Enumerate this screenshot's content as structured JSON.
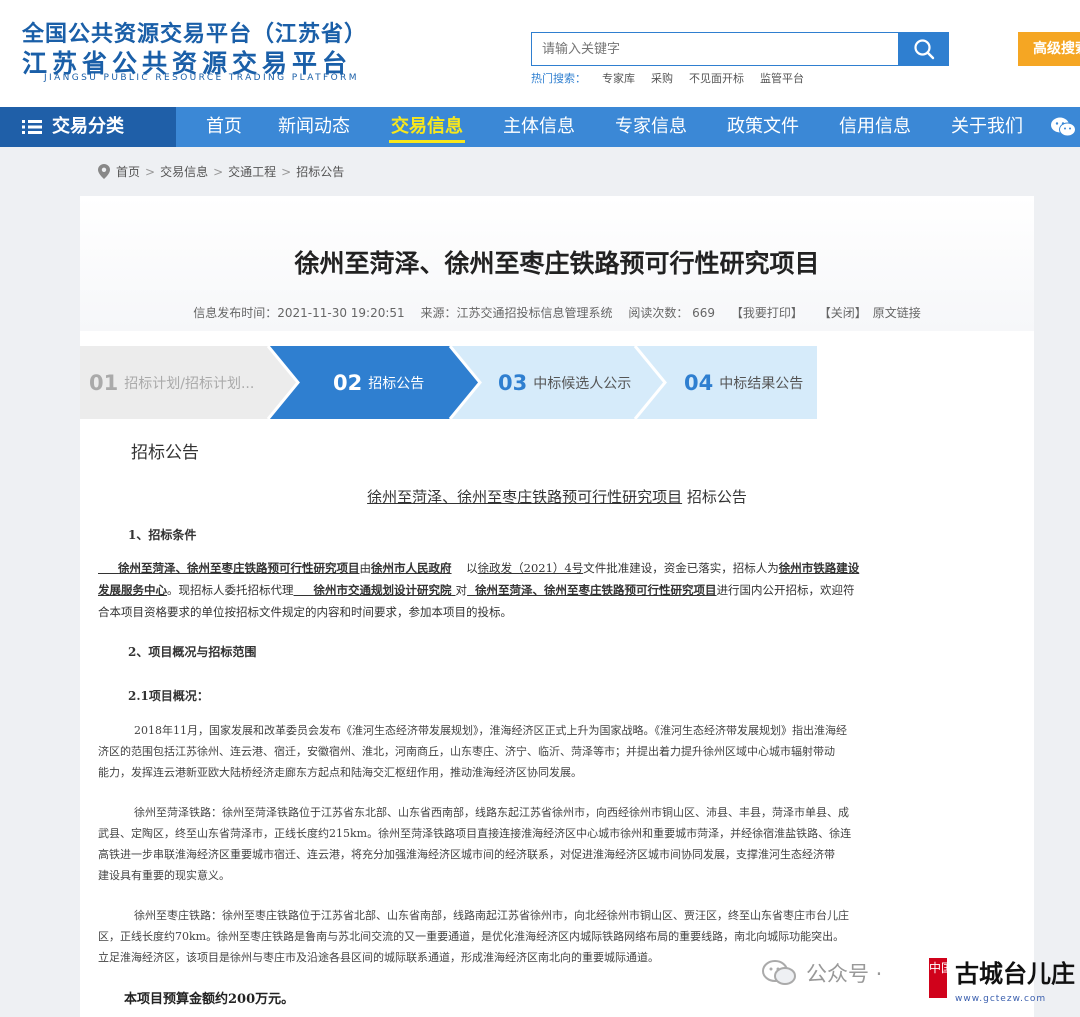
{
  "header": {
    "logo_line1": "全国公共资源交易平台（江苏省）",
    "logo_line2": "江苏省公共资源交易平台",
    "logo_en": "JIANGSU PUBLIC RESOURCE TRADING PLATFORM",
    "search_placeholder": "请输入关键字",
    "hot_label": "热门搜索：",
    "hot_items": [
      "专家库",
      "采购",
      "不见面开标",
      "监管平台"
    ],
    "advanced_search": "高级搜索"
  },
  "nav": {
    "category": "交易分类",
    "items": [
      "首页",
      "新闻动态",
      "交易信息",
      "主体信息",
      "专家信息",
      "政策文件",
      "信用信息",
      "关于我们"
    ],
    "active_index": 2
  },
  "breadcrumb": [
    "首页",
    "交易信息",
    "交通工程",
    "招标公告"
  ],
  "article": {
    "title": "徐州至菏泽、徐州至枣庄铁路预可行性研究项目",
    "meta": {
      "publish_time": "信息发布时间：2021-11-30 19:20:51",
      "source": "来源：江苏交通招投标信息管理系统",
      "views": "阅读次数：  669",
      "print": "【我要打印】",
      "close": "【关闭】",
      "original": "原文链接"
    },
    "steps": [
      {
        "num": "01",
        "label": "招标计划/招标计划..."
      },
      {
        "num": "02",
        "label": "招标公告"
      },
      {
        "num": "03",
        "label": "中标候选人公示"
      },
      {
        "num": "04",
        "label": "中标结果公告"
      }
    ],
    "active_step": 1,
    "section_heading": "招标公告",
    "sub_title_project": "徐州至菏泽、徐州至枣庄铁路预可行性研究项目",
    "sub_title_suffix": "招标公告",
    "h1_title": "1、招标条件",
    "cond_line1": {
      "project": "徐州至菏泽、徐州至枣庄铁路预可行性研究项目",
      "t1": "由",
      "org": "徐州市人民政府",
      "t2": "以",
      "doc": "徐政发（2021）4号",
      "t3": "文件批准建设，资金已落实，招标人为",
      "tenderer": "徐州市铁路建设"
    },
    "cond_line2": {
      "tenderer2": "发展服务中心",
      "t1": "。现招标人委托招标代理",
      "agent": "徐州市交通规划设计研究院",
      "t2": "对",
      "project": "徐州至菏泽、徐州至枣庄铁路预可行性研究项目",
      "t3": "进行国内公开招标，欢迎符"
    },
    "cond_line3": "合本项目资格要求的单位按招标文件规定的内容和时间要求，参加本项目的投标。",
    "h2_title": "2、项目概况与招标范围",
    "h21_title": "2.1项目概况：",
    "para1": [
      "2018年11月，国家发展和改革委员会发布《淮河生态经济带发展规划》，淮海经济区正式上升为国家战略。《淮河生态经济带发展规划》指出淮海经",
      "济区的范围包括江苏徐州、连云港、宿迁，安徽宿州、淮北，河南商丘，山东枣庄、济宁、临沂、菏泽等市；并提出着力提升徐州区域中心城市辐射带动",
      "能力，发挥连云港新亚欧大陆桥经济走廊东方起点和陆海交汇枢纽作用，推动淮海经济区协同发展。"
    ],
    "para2": [
      "徐州至菏泽铁路：徐州至菏泽铁路位于江苏省东北部、山东省西南部，线路东起江苏省徐州市，向西经徐州市铜山区、沛县、丰县，菏泽市单县、成",
      "武县、定陶区，终至山东省菏泽市，正线长度约215km。徐州至菏泽铁路项目直接连接淮海经济区中心城市徐州和重要城市菏泽，并经徐宿淮盐铁路、徐连",
      "高铁进一步串联淮海经济区重要城市宿迁、连云港，将充分加强淮海经济区城市间的经济联系，对促进淮海经济区城市间协同发展，支撑淮河生态经济带",
      "建设具有重要的现实意义。"
    ],
    "para3": [
      "徐州至枣庄铁路：徐州至枣庄铁路位于江苏省北部、山东省南部，线路南起江苏省徐州市，向北经徐州市铜山区、贾汪区，终至山东省枣庄市台儿庄",
      "区，正线长度约70km。徐州至枣庄铁路是鲁南与苏北间交流的又一重要通道，是优化淮海经济区内城际铁路网络布局的重要线路，南北向城际功能突出。",
      "立足淮海经济区，该项目是徐州与枣庄市及沿途各县区间的城际联系通道，形成淮海经济区南北向的重要城际通道。"
    ],
    "budget": "本项目预算金额约200万元。"
  },
  "watermark": {
    "official_account": "公众号 ·",
    "seal_text": "中国",
    "name": "古城台儿庄",
    "url": "www.gctezw.com"
  },
  "colors": {
    "nav_bg": "#3b88d6",
    "nav_category_bg": "#1f5fa8",
    "active_nav": "#f8e71c",
    "step_active": "#2f7fd0",
    "step_next": "#d6ebfa",
    "step_past": "#ececec",
    "advanced_btn": "#f5a623"
  }
}
